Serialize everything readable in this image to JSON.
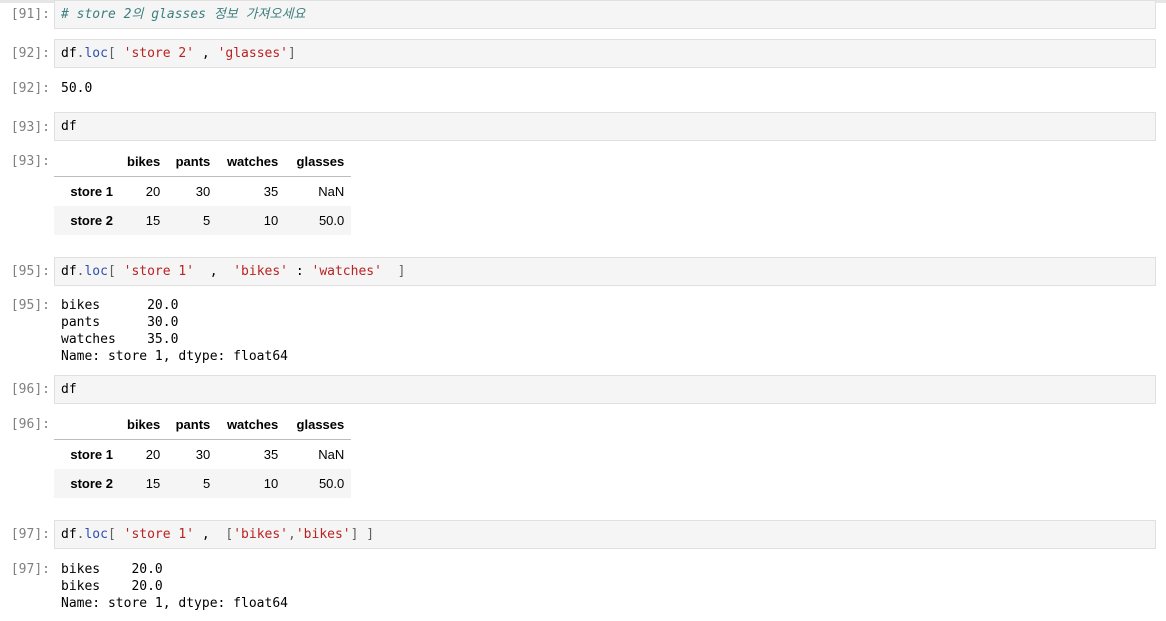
{
  "cells": {
    "c91": {
      "prompt": "[91]:",
      "comment": "# store 2의 glasses 정보 가져오세요"
    },
    "c92": {
      "prompt": "[92]:",
      "code": {
        "obj": "df",
        "dot": ".",
        "fn": "loc",
        "open": "[ ",
        "arg1": "'store 2'",
        "sep": " , ",
        "arg2": "'glasses'",
        "close": "]"
      },
      "out_prompt": "[92]:",
      "output": "50.0"
    },
    "c93": {
      "prompt": "[93]:",
      "code": "df",
      "out_prompt": "[93]:"
    },
    "c95": {
      "prompt": "[95]:",
      "code": {
        "obj": "df",
        "dot": ".",
        "fn": "loc",
        "open": "[ ",
        "arg1": "'store 1'",
        "sep": "  ,  ",
        "arg2": "'bikes'",
        "colon": " : ",
        "arg3": "'watches'",
        "close": "  ]"
      },
      "out_prompt": "[95]:",
      "output": "bikes      20.0\npants      30.0\nwatches    35.0\nName: store 1, dtype: float64"
    },
    "c96": {
      "prompt": "[96]:",
      "code": "df",
      "out_prompt": "[96]:"
    },
    "c97": {
      "prompt": "[97]:",
      "code": {
        "obj": "df",
        "dot": ".",
        "fn": "loc",
        "open": "[ ",
        "arg1": "'store 1'",
        "sep": " ,  ",
        "lb": "[",
        "arg2": "'bikes'",
        "comma": ",",
        "arg3": "'bikes'",
        "rb": "]",
        "close": " ]"
      },
      "out_prompt": "[97]:",
      "output": "bikes    20.0\nbikes    20.0\nName: store 1, dtype: float64"
    }
  },
  "table": {
    "columns": [
      "",
      "bikes",
      "pants",
      "watches",
      "glasses"
    ],
    "rows": [
      {
        "index": "store 1",
        "values": [
          "20",
          "30",
          "35",
          "NaN"
        ]
      },
      {
        "index": "store 2",
        "values": [
          "15",
          "5",
          "10",
          "50.0"
        ]
      }
    ]
  }
}
